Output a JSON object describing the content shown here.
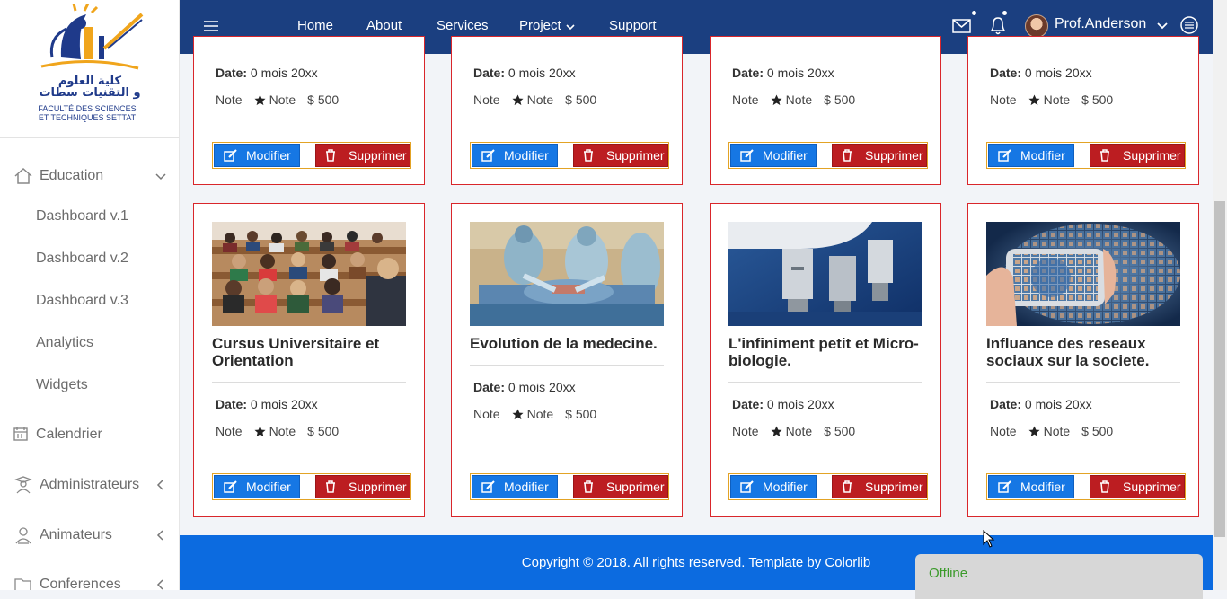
{
  "logo": {
    "arabic_line1": "كلية العلوم",
    "arabic_line2": "و التقنيات سطات",
    "french_line1": "FACULTÉ DES SCIENCES",
    "french_line2": "ET TECHNIQUES SETTAT"
  },
  "sidebar": {
    "education": "Education",
    "sub_items": [
      "Dashboard v.1",
      "Dashboard v.2",
      "Dashboard v.3",
      "Analytics",
      "Widgets"
    ],
    "calendrier": "Calendrier",
    "administrateurs": "Administrateurs",
    "animateurs": "Animateurs",
    "conferences": "Conferences"
  },
  "header": {
    "nav": [
      "Home",
      "About",
      "Services",
      "Project",
      "Support"
    ],
    "user_name": "Prof.Anderson"
  },
  "cards_top": [
    {
      "date_label": "Date:",
      "date_value": "0 mois 20xx",
      "note_label": "Note",
      "star_note": "Note",
      "price": "500",
      "modify": "Modifier",
      "delete": "Supprimer"
    },
    {
      "date_label": "Date:",
      "date_value": "0 mois 20xx",
      "note_label": "Note",
      "star_note": "Note",
      "price": "500",
      "modify": "Modifier",
      "delete": "Supprimer"
    },
    {
      "date_label": "Date:",
      "date_value": "0 mois 20xx",
      "note_label": "Note",
      "star_note": "Note",
      "price": "500",
      "modify": "Modifier",
      "delete": "Supprimer"
    },
    {
      "date_label": "Date:",
      "date_value": "0 mois 20xx",
      "note_label": "Note",
      "star_note": "Note",
      "price": "500",
      "modify": "Modifier",
      "delete": "Supprimer"
    }
  ],
  "cards_bottom": [
    {
      "title": "Cursus Universitaire et Orientation",
      "date_label": "Date:",
      "date_value": "0 mois 20xx",
      "note_label": "Note",
      "star_note": "Note",
      "price": "500",
      "modify": "Modifier",
      "delete": "Supprimer"
    },
    {
      "title": "Evolution de la medecine.",
      "date_label": "Date:",
      "date_value": "0 mois 20xx",
      "note_label": "Note",
      "star_note": "Note",
      "price": "500",
      "modify": "Modifier",
      "delete": "Supprimer"
    },
    {
      "title": "L'infiniment petit et Micro-biologie.",
      "date_label": "Date:",
      "date_value": "0 mois 20xx",
      "note_label": "Note",
      "star_note": "Note",
      "price": "500",
      "modify": "Modifier",
      "delete": "Supprimer"
    },
    {
      "title": "Influance des reseaux sociaux sur la societe.",
      "date_label": "Date:",
      "date_value": "0 mois 20xx",
      "note_label": "Note",
      "star_note": "Note",
      "price": "500",
      "modify": "Modifier",
      "delete": "Supprimer"
    }
  ],
  "footer": {
    "copyright": "Copyright © 2018. All rights reserved. Template by Colorlib"
  },
  "chat": {
    "status": "Offline"
  },
  "colors": {
    "header_bg": "#1b3f80",
    "footer_bg": "#0c6be0",
    "card_border": "#d9262b",
    "modify_btn": "#1677e4",
    "delete_btn": "#bc1d21",
    "offline_text": "#3a9a2a"
  }
}
